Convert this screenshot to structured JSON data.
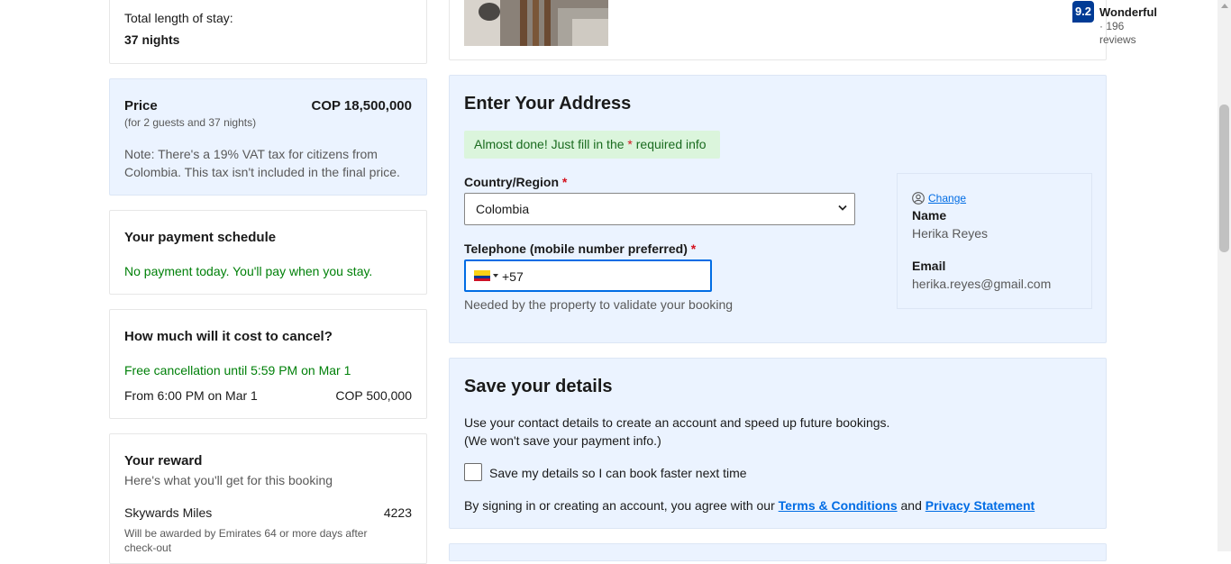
{
  "stay": {
    "label": "Total length of stay:",
    "value": "37 nights"
  },
  "price": {
    "label": "Price",
    "amount": "COP 18,500,000",
    "sub": "(for 2 guests and 37 nights)",
    "note_line1": "Note: There's a 19% VAT tax for citizens from",
    "note_line2": "Colombia. This tax isn't included in the final price."
  },
  "schedule": {
    "title": "Your payment schedule",
    "text": "No payment today. You'll pay when you stay."
  },
  "cancel": {
    "title": "How much will it cost to cancel?",
    "free": "Free cancellation until 5:59 PM on Mar 1",
    "from": "From 6:00 PM on Mar 1",
    "fee": "COP 500,000"
  },
  "reward": {
    "title": "Your reward",
    "subtitle": "Here's what you'll get for this booking",
    "label": "Skywards Miles",
    "value": "4223",
    "note_line1": "Will be awarded by Emirates 64 or more days after",
    "note_line2": "check-out"
  },
  "property": {
    "score": "9.2",
    "rating_word": "Wonderful",
    "reviews": "· 196 reviews"
  },
  "address": {
    "title": "Enter Your Address",
    "alert_pre": "Almost done! Just fill in the",
    "alert_star": "*",
    "alert_post": "required info",
    "country_label": "Country/Region",
    "star": "*",
    "country_value": "Colombia",
    "phone_label": "Telephone (mobile number preferred)",
    "phone_value": "+57",
    "phone_help": "Needed by the property to validate your booking"
  },
  "profile": {
    "change": "Change",
    "name_label": "Name",
    "name_value": "Herika Reyes",
    "email_label": "Email",
    "email_value": "herika.reyes@gmail.com"
  },
  "save": {
    "title": "Save your details",
    "desc_line1": "Use your contact details to create an account and speed up future bookings.",
    "desc_line2": "(We won't save your payment info.)",
    "checkbox_label": "Save my details so I can book faster next time",
    "terms_pre": "By signing in or creating an account, you agree with our",
    "terms_link": "Terms & Conditions",
    "and": "and",
    "privacy_link": "Privacy Statement"
  },
  "colors": {
    "blue_panel": "#ebf3ff",
    "link": "#006ce4",
    "green": "#008009",
    "required": "#d4111e"
  }
}
